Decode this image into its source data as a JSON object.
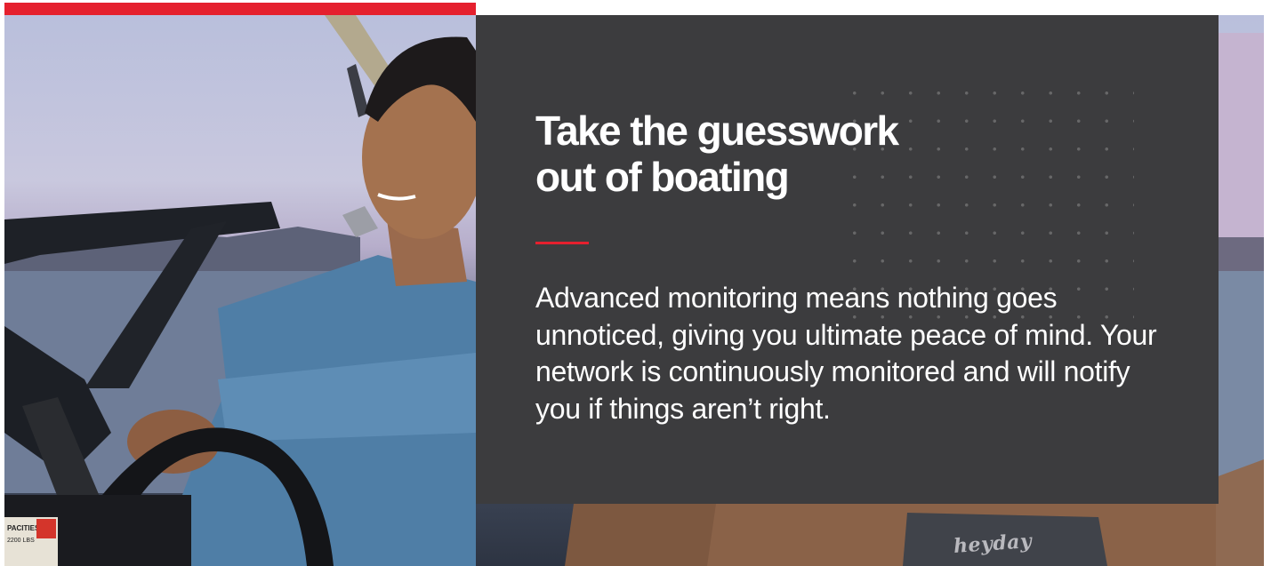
{
  "hero": {
    "headline": "Take the guesswork\nout of boating",
    "body": "Advanced monitoring means nothing goes unnoticed, giving you ultimate peace of mind. Your network is continuously monitored and will notify you if things aren’t right.",
    "image_brand_text": "heyday",
    "image_sticker_text": "PACITIES",
    "image_capacity_text": "2200 LBS"
  },
  "colors": {
    "accent": "#e5202e",
    "panel_background": "#3c3c3e",
    "text": "#ffffff",
    "shirt": "#4f7ea6",
    "seat": "#8a6248"
  },
  "icons": {
    "pattern": "dot-grid-pattern"
  }
}
